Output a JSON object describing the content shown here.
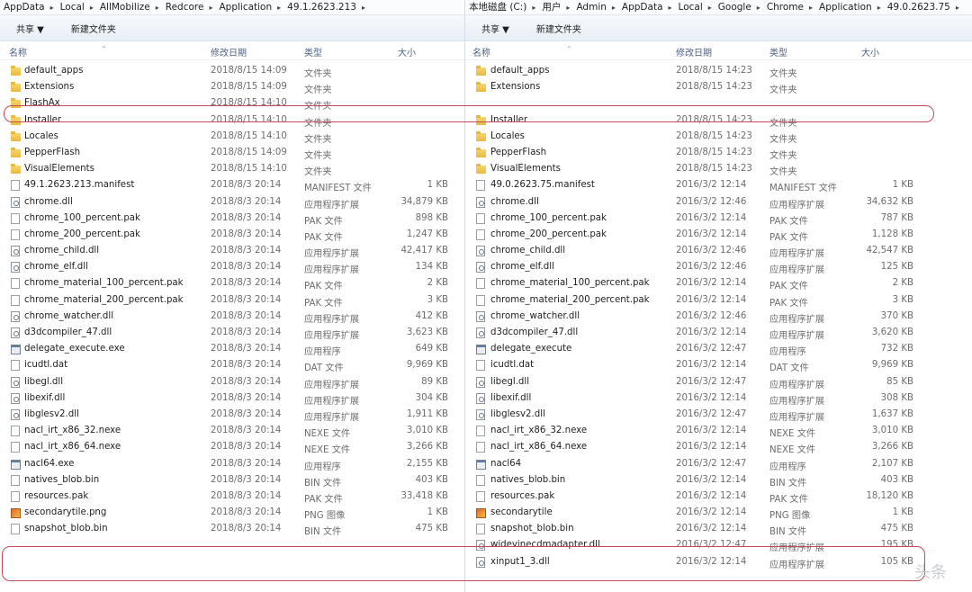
{
  "left": {
    "breadcrumb": [
      "AppData",
      "Local",
      "AllMobilize",
      "Redcore",
      "Application",
      "49.1.2623.213"
    ],
    "toolbar": {
      "share": "共享 ▼",
      "new_folder": "新建文件夹"
    },
    "columns": {
      "name": "名称",
      "date": "修改日期",
      "type": "类型",
      "size": "大小"
    },
    "rows": [
      {
        "icon": "folder",
        "name": "default_apps",
        "date": "2018/8/15 14:09",
        "type": "文件夹",
        "size": ""
      },
      {
        "icon": "folder",
        "name": "Extensions",
        "date": "2018/8/15 14:09",
        "type": "文件夹",
        "size": ""
      },
      {
        "icon": "folder",
        "name": "FlashAx",
        "date": "2018/8/15 14:10",
        "type": "文件夹",
        "size": ""
      },
      {
        "icon": "folder",
        "name": "Installer",
        "date": "2018/8/15 14:10",
        "type": "文件夹",
        "size": ""
      },
      {
        "icon": "folder",
        "name": "Locales",
        "date": "2018/8/15 14:10",
        "type": "文件夹",
        "size": ""
      },
      {
        "icon": "folder",
        "name": "PepperFlash",
        "date": "2018/8/15 14:09",
        "type": "文件夹",
        "size": ""
      },
      {
        "icon": "folder",
        "name": "VisualElements",
        "date": "2018/8/15 14:10",
        "type": "文件夹",
        "size": ""
      },
      {
        "icon": "file",
        "name": "49.1.2623.213.manifest",
        "date": "2018/8/3 20:14",
        "type": "MANIFEST 文件",
        "size": "1 KB"
      },
      {
        "icon": "dll",
        "name": "chrome.dll",
        "date": "2018/8/3 20:14",
        "type": "应用程序扩展",
        "size": "34,879 KB"
      },
      {
        "icon": "file",
        "name": "chrome_100_percent.pak",
        "date": "2018/8/3 20:14",
        "type": "PAK 文件",
        "size": "898 KB"
      },
      {
        "icon": "file",
        "name": "chrome_200_percent.pak",
        "date": "2018/8/3 20:14",
        "type": "PAK 文件",
        "size": "1,247 KB"
      },
      {
        "icon": "dll",
        "name": "chrome_child.dll",
        "date": "2018/8/3 20:14",
        "type": "应用程序扩展",
        "size": "42,417 KB"
      },
      {
        "icon": "dll",
        "name": "chrome_elf.dll",
        "date": "2018/8/3 20:14",
        "type": "应用程序扩展",
        "size": "134 KB"
      },
      {
        "icon": "file",
        "name": "chrome_material_100_percent.pak",
        "date": "2018/8/3 20:14",
        "type": "PAK 文件",
        "size": "2 KB"
      },
      {
        "icon": "file",
        "name": "chrome_material_200_percent.pak",
        "date": "2018/8/3 20:14",
        "type": "PAK 文件",
        "size": "3 KB"
      },
      {
        "icon": "dll",
        "name": "chrome_watcher.dll",
        "date": "2018/8/3 20:14",
        "type": "应用程序扩展",
        "size": "412 KB"
      },
      {
        "icon": "dll",
        "name": "d3dcompiler_47.dll",
        "date": "2018/8/3 20:14",
        "type": "应用程序扩展",
        "size": "3,623 KB"
      },
      {
        "icon": "exe",
        "name": "delegate_execute.exe",
        "date": "2018/8/3 20:14",
        "type": "应用程序",
        "size": "649 KB"
      },
      {
        "icon": "file",
        "name": "icudtl.dat",
        "date": "2018/8/3 20:14",
        "type": "DAT 文件",
        "size": "9,969 KB"
      },
      {
        "icon": "dll",
        "name": "libegl.dll",
        "date": "2018/8/3 20:14",
        "type": "应用程序扩展",
        "size": "89 KB"
      },
      {
        "icon": "dll",
        "name": "libexif.dll",
        "date": "2018/8/3 20:14",
        "type": "应用程序扩展",
        "size": "304 KB"
      },
      {
        "icon": "dll",
        "name": "libglesv2.dll",
        "date": "2018/8/3 20:14",
        "type": "应用程序扩展",
        "size": "1,911 KB"
      },
      {
        "icon": "file",
        "name": "nacl_irt_x86_32.nexe",
        "date": "2018/8/3 20:14",
        "type": "NEXE 文件",
        "size": "3,010 KB"
      },
      {
        "icon": "file",
        "name": "nacl_irt_x86_64.nexe",
        "date": "2018/8/3 20:14",
        "type": "NEXE 文件",
        "size": "3,266 KB"
      },
      {
        "icon": "exe",
        "name": "nacl64.exe",
        "date": "2018/8/3 20:14",
        "type": "应用程序",
        "size": "2,155 KB"
      },
      {
        "icon": "file",
        "name": "natives_blob.bin",
        "date": "2018/8/3 20:14",
        "type": "BIN 文件",
        "size": "403 KB"
      },
      {
        "icon": "file",
        "name": "resources.pak",
        "date": "2018/8/3 20:14",
        "type": "PAK 文件",
        "size": "33,418 KB"
      },
      {
        "icon": "png",
        "name": "secondarytile.png",
        "date": "2018/8/3 20:14",
        "type": "PNG 图像",
        "size": "1 KB"
      },
      {
        "icon": "file",
        "name": "snapshot_blob.bin",
        "date": "2018/8/3 20:14",
        "type": "BIN 文件",
        "size": "475 KB"
      }
    ]
  },
  "right": {
    "breadcrumb": [
      "本地磁盘 (C:)",
      "用户",
      "Admin",
      "AppData",
      "Local",
      "Google",
      "Chrome",
      "Application",
      "49.0.2623.75"
    ],
    "toolbar": {
      "share": "共享 ▼",
      "new_folder": "新建文件夹"
    },
    "columns": {
      "name": "名称",
      "date": "修改日期",
      "type": "类型",
      "size": "大小"
    },
    "rows": [
      {
        "icon": "folder",
        "name": "default_apps",
        "date": "2018/8/15 14:23",
        "type": "文件夹",
        "size": ""
      },
      {
        "icon": "folder",
        "name": "Extensions",
        "date": "2018/8/15 14:23",
        "type": "文件夹",
        "size": ""
      },
      {
        "icon": "none",
        "name": "",
        "date": "",
        "type": "",
        "size": ""
      },
      {
        "icon": "folder",
        "name": "Installer",
        "date": "2018/8/15 14:23",
        "type": "文件夹",
        "size": ""
      },
      {
        "icon": "folder",
        "name": "Locales",
        "date": "2018/8/15 14:23",
        "type": "文件夹",
        "size": ""
      },
      {
        "icon": "folder",
        "name": "PepperFlash",
        "date": "2018/8/15 14:23",
        "type": "文件夹",
        "size": ""
      },
      {
        "icon": "folder",
        "name": "VisualElements",
        "date": "2018/8/15 14:23",
        "type": "文件夹",
        "size": ""
      },
      {
        "icon": "file",
        "name": "49.0.2623.75.manifest",
        "date": "2016/3/2 12:14",
        "type": "MANIFEST 文件",
        "size": "1 KB"
      },
      {
        "icon": "dll",
        "name": "chrome.dll",
        "date": "2016/3/2 12:46",
        "type": "应用程序扩展",
        "size": "34,632 KB"
      },
      {
        "icon": "file",
        "name": "chrome_100_percent.pak",
        "date": "2016/3/2 12:14",
        "type": "PAK 文件",
        "size": "787 KB"
      },
      {
        "icon": "file",
        "name": "chrome_200_percent.pak",
        "date": "2016/3/2 12:14",
        "type": "PAK 文件",
        "size": "1,128 KB"
      },
      {
        "icon": "dll",
        "name": "chrome_child.dll",
        "date": "2016/3/2 12:46",
        "type": "应用程序扩展",
        "size": "42,547 KB"
      },
      {
        "icon": "dll",
        "name": "chrome_elf.dll",
        "date": "2016/3/2 12:46",
        "type": "应用程序扩展",
        "size": "125 KB"
      },
      {
        "icon": "file",
        "name": "chrome_material_100_percent.pak",
        "date": "2016/3/2 12:14",
        "type": "PAK 文件",
        "size": "2 KB"
      },
      {
        "icon": "file",
        "name": "chrome_material_200_percent.pak",
        "date": "2016/3/2 12:14",
        "type": "PAK 文件",
        "size": "3 KB"
      },
      {
        "icon": "dll",
        "name": "chrome_watcher.dll",
        "date": "2016/3/2 12:46",
        "type": "应用程序扩展",
        "size": "370 KB"
      },
      {
        "icon": "dll",
        "name": "d3dcompiler_47.dll",
        "date": "2016/3/2 12:14",
        "type": "应用程序扩展",
        "size": "3,620 KB"
      },
      {
        "icon": "exe",
        "name": "delegate_execute",
        "date": "2016/3/2 12:47",
        "type": "应用程序",
        "size": "732 KB"
      },
      {
        "icon": "file",
        "name": "icudtl.dat",
        "date": "2016/3/2 12:14",
        "type": "DAT 文件",
        "size": "9,969 KB"
      },
      {
        "icon": "dll",
        "name": "libegl.dll",
        "date": "2016/3/2 12:47",
        "type": "应用程序扩展",
        "size": "85 KB"
      },
      {
        "icon": "dll",
        "name": "libexif.dll",
        "date": "2016/3/2 12:14",
        "type": "应用程序扩展",
        "size": "308 KB"
      },
      {
        "icon": "dll",
        "name": "libglesv2.dll",
        "date": "2016/3/2 12:47",
        "type": "应用程序扩展",
        "size": "1,637 KB"
      },
      {
        "icon": "file",
        "name": "nacl_irt_x86_32.nexe",
        "date": "2016/3/2 12:14",
        "type": "NEXE 文件",
        "size": "3,010 KB"
      },
      {
        "icon": "file",
        "name": "nacl_irt_x86_64.nexe",
        "date": "2016/3/2 12:14",
        "type": "NEXE 文件",
        "size": "3,266 KB"
      },
      {
        "icon": "exe",
        "name": "nacl64",
        "date": "2016/3/2 12:47",
        "type": "应用程序",
        "size": "2,107 KB"
      },
      {
        "icon": "file",
        "name": "natives_blob.bin",
        "date": "2016/3/2 12:14",
        "type": "BIN 文件",
        "size": "403 KB"
      },
      {
        "icon": "file",
        "name": "resources.pak",
        "date": "2016/3/2 12:14",
        "type": "PAK 文件",
        "size": "18,120 KB"
      },
      {
        "icon": "png",
        "name": "secondarytile",
        "date": "2016/3/2 12:14",
        "type": "PNG 图像",
        "size": "1 KB"
      },
      {
        "icon": "file",
        "name": "snapshot_blob.bin",
        "date": "2016/3/2 12:14",
        "type": "BIN 文件",
        "size": "475 KB"
      },
      {
        "icon": "dll",
        "name": "widevinecdmadapter.dll",
        "date": "2016/3/2 12:47",
        "type": "应用程序扩展",
        "size": "195 KB"
      },
      {
        "icon": "dll",
        "name": "xinput1_3.dll",
        "date": "2016/3/2 12:14",
        "type": "应用程序扩展",
        "size": "105 KB"
      }
    ]
  },
  "colors": {
    "highlight": "#c44a5a",
    "header_text": "#4d6185"
  },
  "watermark": "头条"
}
